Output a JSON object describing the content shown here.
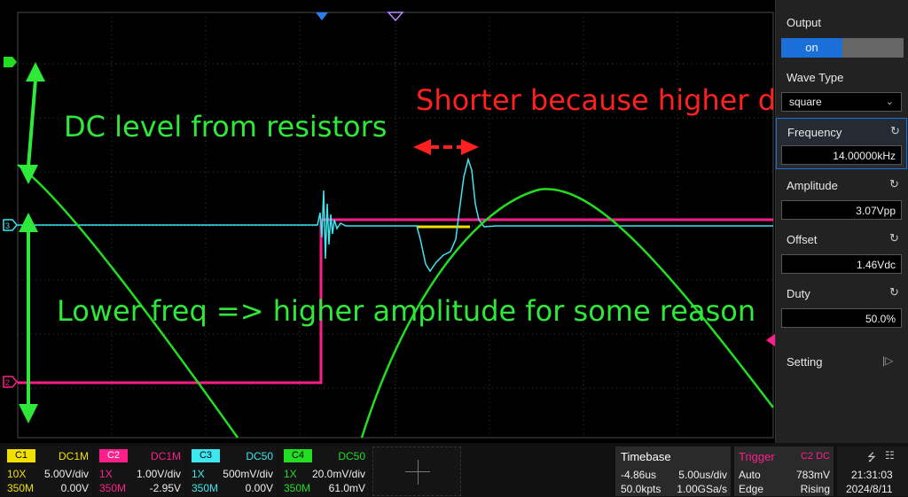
{
  "colors": {
    "c1": "#f0e000",
    "c2": "#ff1f8a",
    "c3": "#3ee6f0",
    "c4": "#22dd22",
    "annotation_green": "#2ee83a",
    "annotation_red": "#ff2020",
    "accent_blue": "#1a6fd8"
  },
  "annotations": {
    "dc_level": "DC level from resistors",
    "shorter": "Shorter because higher di/dt",
    "lower_freq": "Lower freq => higher amplitude for some reason"
  },
  "wavegen": {
    "output_label": "Output",
    "output_state": "on",
    "wave_type_label": "Wave Type",
    "wave_type_value": "square",
    "frequency_label": "Frequency",
    "frequency_value": "14.00000kHz",
    "amplitude_label": "Amplitude",
    "amplitude_value": "3.07Vpp",
    "offset_label": "Offset",
    "offset_value": "1.46Vdc",
    "duty_label": "Duty",
    "duty_value": "50.0%",
    "setting_label": "Setting"
  },
  "channels": [
    {
      "name": "C1",
      "coupling": "DC1M",
      "probe": "10X",
      "scale": "5.00V/div",
      "bw": "350M",
      "offset": "0.00V"
    },
    {
      "name": "C2",
      "coupling": "DC1M",
      "probe": "1X",
      "scale": "1.00V/div",
      "bw": "350M",
      "offset": "-2.95V"
    },
    {
      "name": "C3",
      "coupling": "DC50",
      "probe": "1X",
      "scale": "500mV/div",
      "bw": "350M",
      "offset": "0.00V"
    },
    {
      "name": "C4",
      "coupling": "DC50",
      "probe": "1X",
      "scale": "20.0mV/div",
      "bw": "350M",
      "offset": "61.0mV"
    }
  ],
  "timebase": {
    "label": "Timebase",
    "delay": "-4.86us",
    "scale": "5.00us/div",
    "points": "50.0kpts",
    "rate": "1.00GSa/s"
  },
  "trigger": {
    "label": "Trigger",
    "source": "C2 DC",
    "mode": "Auto",
    "level": "783mV",
    "type": "Edge",
    "slope": "Rising"
  },
  "status": {
    "time": "21:31:03",
    "date": "2024/8/11"
  },
  "markers": {
    "c1": "1",
    "c2": "2",
    "c3": "3"
  }
}
